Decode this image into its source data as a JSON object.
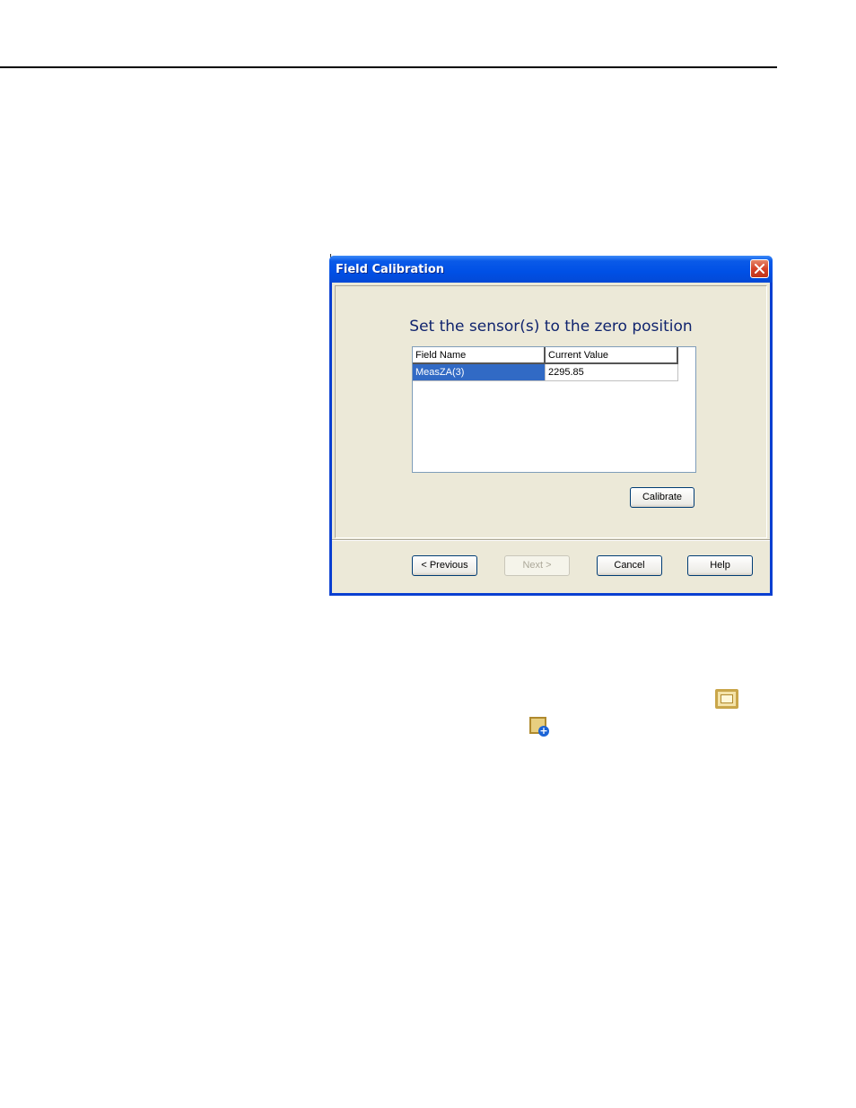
{
  "dialog": {
    "title": "Field Calibration",
    "instruction": "Set the sensor(s) to the zero position",
    "grid": {
      "columns": [
        "Field Name",
        "Current Value"
      ],
      "rows": [
        {
          "field_name": "MeasZA(3)",
          "current_value": "2295.85",
          "selected": true
        }
      ]
    },
    "calibrate_label": "Calibrate",
    "footer": {
      "previous_label": "< Previous",
      "next_label": "Next >",
      "cancel_label": "Cancel",
      "help_label": "Help"
    }
  },
  "colors": {
    "title_bar": "#0054e3",
    "dialog_face": "#ece9d8",
    "heading_text": "#10246e",
    "selection": "#316ac5",
    "close_button": "#d5432a"
  },
  "icons": [
    "close-icon",
    "graph-document-icon",
    "add-graph-document-icon"
  ]
}
